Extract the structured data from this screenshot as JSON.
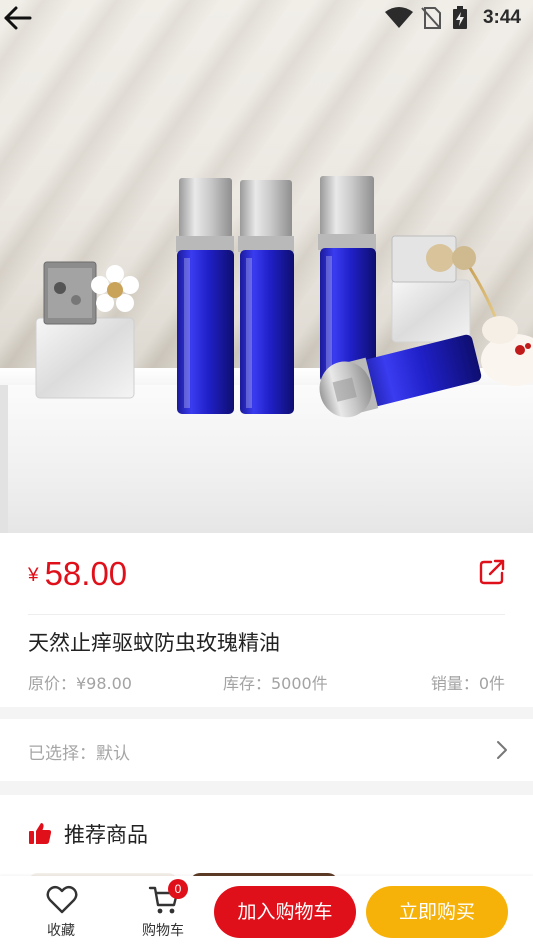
{
  "status_bar": {
    "time": "3:44",
    "icons": [
      "wifi-icon",
      "no-sim-icon",
      "battery-charging-icon"
    ]
  },
  "header": {
    "back_icon": "arrow-left-icon"
  },
  "product": {
    "currency": "¥",
    "price": "58.00",
    "title": "天然止痒驱蚊防虫玫瑰精油",
    "original_price": "原价：¥98.00",
    "stock": "库存：5000件",
    "sales": "销量：0件",
    "share_icon": "share-icon"
  },
  "selection": {
    "label": "已选择：默认",
    "chevron_icon": "chevron-right-icon"
  },
  "recommend": {
    "heading": "推荐商品",
    "heading_icon": "thumbs-up-icon"
  },
  "bottom_bar": {
    "favorite_label": "收藏",
    "cart_label": "购物车",
    "cart_count": "0",
    "add_to_cart_label": "加入购物车",
    "buy_now_label": "立即购买"
  },
  "colors": {
    "accent_red": "#e0101b",
    "accent_yellow": "#f7b20a",
    "muted_text": "#a3a3a3"
  }
}
